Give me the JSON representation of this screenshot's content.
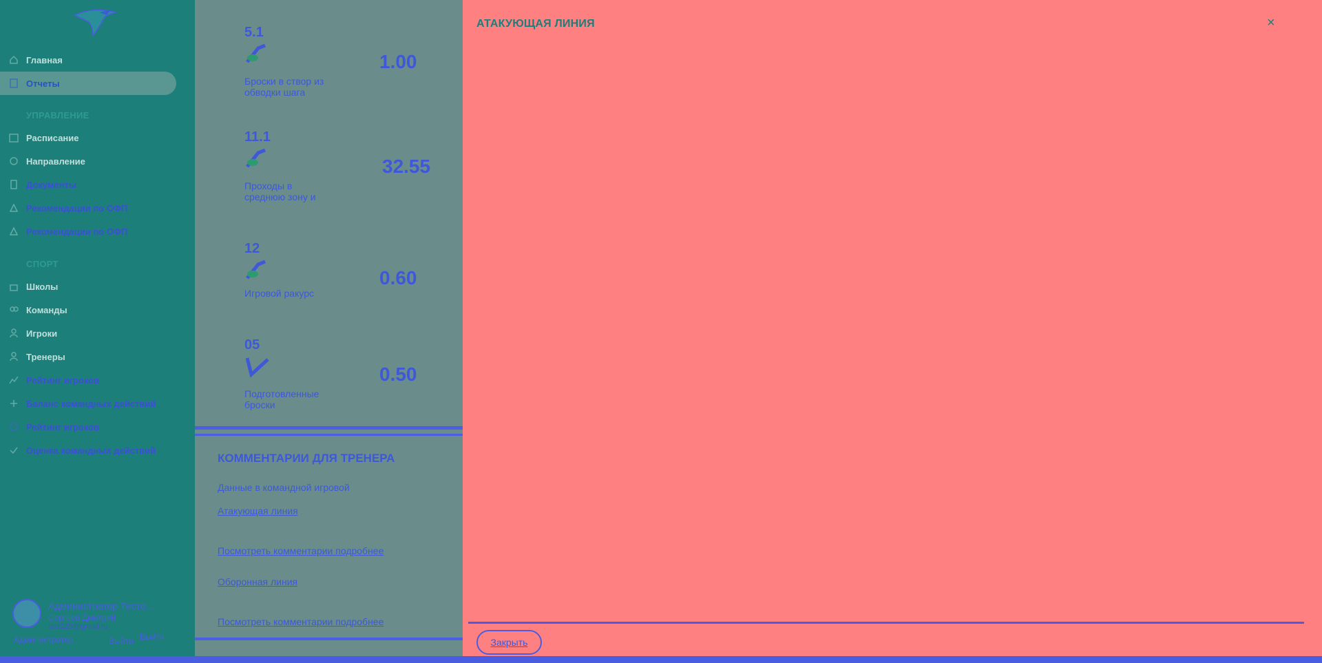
{
  "sidebar": {
    "items": [
      {
        "label": "Главная",
        "icon": "home-icon"
      },
      {
        "label": "Отчеты",
        "icon": "document-icon",
        "active": true
      }
    ],
    "section_manage": "УПРАВЛЕНИЕ",
    "manage_items": [
      {
        "label": "Расписание",
        "icon": "calendar-icon"
      },
      {
        "label": "Направление",
        "icon": "direction-icon"
      },
      {
        "label": "Документы",
        "icon": "file-icon"
      },
      {
        "label": "Рекомендации по ОФП",
        "icon": "advice-icon"
      },
      {
        "label": "Рекомендации по ОФП",
        "icon": "advice-icon"
      }
    ],
    "section_sport": "СПОРТ",
    "sport_items": [
      {
        "label": "Школы",
        "icon": "school-icon"
      },
      {
        "label": "Команды",
        "icon": "team-icon"
      },
      {
        "label": "Игроки",
        "icon": "player-icon"
      },
      {
        "label": "Тренеры",
        "icon": "coach-icon"
      },
      {
        "label": "Рейтинг игроков",
        "icon": "rating-icon"
      },
      {
        "label": "Баланс командных действий",
        "icon": "balance-icon"
      },
      {
        "label": "Рейтинг игроков",
        "icon": "star-icon"
      },
      {
        "label": "Оценка командных действий",
        "icon": "check-icon"
      }
    ],
    "user": {
      "name": "Администратор Тесто...",
      "sub": "Сергеев Дмитрий",
      "email": "test123@gmail.ru",
      "role": "Администратор",
      "logout": "Выйти"
    }
  },
  "stats": [
    {
      "code": "5.1",
      "value": "1.00",
      "label": "Броски в створ из обводки шага"
    },
    {
      "code": "11.1",
      "value": "32.55",
      "label": "Проходы в среднюю зону и"
    },
    {
      "code": "12",
      "value": "0.60",
      "label": "Игровой ракурс"
    },
    {
      "code": "05",
      "value": "0.50",
      "label": "Подготовленные броски"
    }
  ],
  "comments": {
    "title": "КОММЕНТАРИИ ДЛЯ ТРЕНЕРА",
    "subtitle": "Данные в командной игровой",
    "link1": "Атакующая линия",
    "link2": "Посмотреть комментарии подробнее",
    "link3": "Оборонная линия",
    "link4": "Посмотреть комментарии подробнее"
  },
  "modal": {
    "title": "АТАКУЮЩАЯ ЛИНИЯ",
    "close_symbol": "×",
    "button_label": "Закрыть"
  },
  "colors": {
    "sidebar": "#1c7f7a",
    "content": "#6a8d8b",
    "modal": "#ff8080",
    "accent": "#4a5de0"
  }
}
